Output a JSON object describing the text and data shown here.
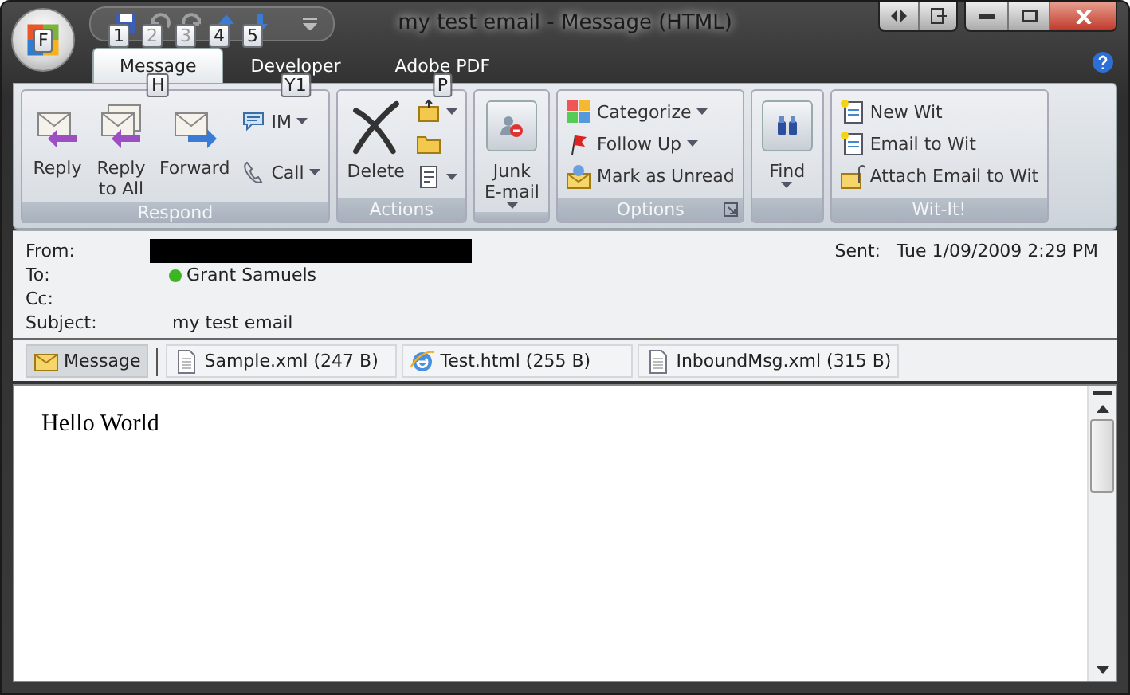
{
  "window": {
    "title": "my test email - Message (HTML)",
    "app_button_keytip": "F"
  },
  "quick_access": [
    {
      "keytip": "1",
      "disabled": false
    },
    {
      "keytip": "2",
      "disabled": true
    },
    {
      "keytip": "3",
      "disabled": true
    },
    {
      "keytip": "4",
      "disabled": false
    },
    {
      "keytip": "5",
      "disabled": false
    }
  ],
  "tabs": [
    {
      "label": "Message",
      "selected": true,
      "keytip": "H"
    },
    {
      "label": "Developer",
      "selected": false,
      "keytip": "Y1"
    },
    {
      "label": "Adobe PDF",
      "selected": false,
      "keytip": "P"
    }
  ],
  "ribbon": [
    {
      "title": "Respond",
      "items": [
        {
          "kind": "large",
          "label": "Reply"
        },
        {
          "kind": "large",
          "label": "Reply\nto All"
        },
        {
          "kind": "large",
          "label": "Forward"
        },
        {
          "kind": "stack",
          "items": [
            {
              "label": "IM",
              "dropdown": true
            },
            {
              "label": "Call",
              "dropdown": true
            }
          ]
        }
      ]
    },
    {
      "title": "Actions",
      "items": [
        {
          "kind": "large",
          "label": "Delete"
        },
        {
          "kind": "stack",
          "items": [
            {
              "dropdown": true
            },
            {
              "dropdown": false
            },
            {
              "dropdown": true
            }
          ]
        }
      ]
    },
    {
      "items": [
        {
          "kind": "boxed",
          "label": "Junk\nE-mail",
          "dropdown": true
        }
      ]
    },
    {
      "title": "Options",
      "launcher": true,
      "items": [
        {
          "kind": "stack",
          "items": [
            {
              "label": "Categorize",
              "dropdown": true
            },
            {
              "label": "Follow Up",
              "dropdown": true
            },
            {
              "label": "Mark as Unread"
            }
          ]
        }
      ]
    },
    {
      "items": [
        {
          "kind": "boxed",
          "label": "Find",
          "dropdown": true
        }
      ]
    },
    {
      "title": "Wit-It!",
      "items": [
        {
          "kind": "stack",
          "items": [
            {
              "label": "New Wit"
            },
            {
              "label": "Email to Wit"
            },
            {
              "label": "Attach Email to Wit"
            }
          ]
        }
      ]
    }
  ],
  "header": {
    "from_label": "From:",
    "sent_label": "Sent:",
    "sent": "Tue 1/09/2009 2:29 PM",
    "to_label": "To:",
    "to": [
      {
        "name": "Grant Samuels",
        "color": "#3cb521"
      }
    ],
    "cc_label": "Cc:",
    "subject_label": "Subject:",
    "subject": "my test email"
  },
  "attachments": [
    {
      "kind": "message",
      "label": "Message",
      "selected": true
    },
    {
      "kind": "xml",
      "label": "Sample.xml (247 B)",
      "selected": false
    },
    {
      "kind": "html",
      "label": "Test.html (255 B)",
      "selected": false
    },
    {
      "kind": "xml",
      "label": "InboundMsg.xml (315 B)",
      "selected": false
    }
  ],
  "body": {
    "text": "Hello World"
  }
}
